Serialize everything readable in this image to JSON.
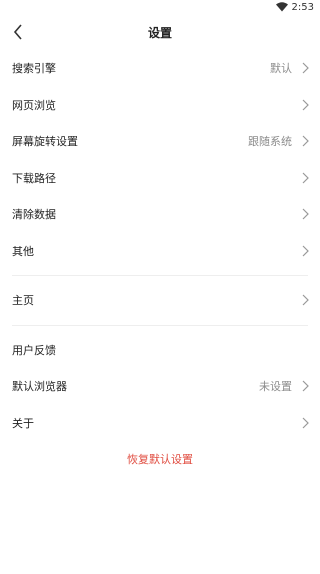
{
  "status_bar": {
    "time": "2:53"
  },
  "header": {
    "title": "设置"
  },
  "group1": [
    {
      "label": "搜索引擎",
      "value": "默认"
    },
    {
      "label": "网页浏览",
      "value": ""
    },
    {
      "label": "屏幕旋转设置",
      "value": "跟随系统"
    },
    {
      "label": "下载路径",
      "value": ""
    },
    {
      "label": "清除数据",
      "value": ""
    },
    {
      "label": "其他",
      "value": ""
    }
  ],
  "group2": [
    {
      "label": "主页",
      "value": ""
    }
  ],
  "group3": [
    {
      "label": "用户反馈",
      "value": ""
    },
    {
      "label": "默认浏览器",
      "value": "未设置"
    },
    {
      "label": "关于",
      "value": ""
    }
  ],
  "restore_label": "恢复默认设置",
  "colors": {
    "accent": "#e04b3f"
  }
}
